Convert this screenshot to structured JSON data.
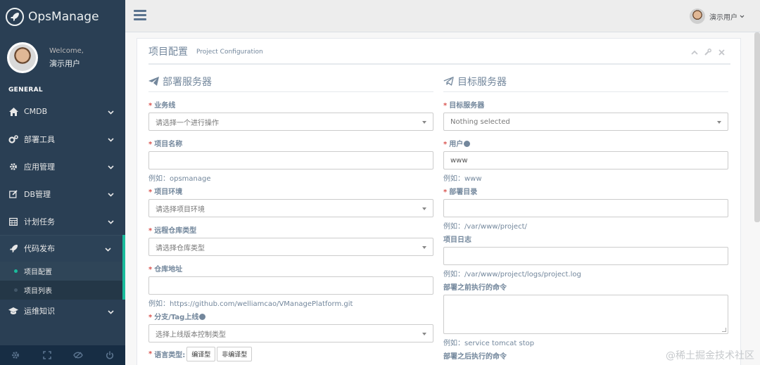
{
  "brand": {
    "name": "OpsManage"
  },
  "profile": {
    "welcome": "Welcome,",
    "name": "演示用户"
  },
  "sidebar": {
    "section": "GENERAL",
    "items": [
      {
        "label": "CMDB",
        "icon": "home-icon"
      },
      {
        "label": "部署工具",
        "icon": "cogs-icon"
      },
      {
        "label": "应用管理",
        "icon": "gear-icon"
      },
      {
        "label": "DB管理",
        "icon": "edit-icon"
      },
      {
        "label": "计划任务",
        "icon": "calendar-icon"
      },
      {
        "label": "代码发布",
        "icon": "rocket-icon"
      }
    ],
    "subitems": [
      {
        "label": "项目配置"
      },
      {
        "label": "项目列表"
      }
    ],
    "last_item": {
      "label": "运维知识",
      "icon": "graduation-cap-icon"
    }
  },
  "topbar": {
    "user": "演示用户"
  },
  "panel": {
    "title": "项目配置",
    "subtitle": "Project Configuration"
  },
  "left": {
    "heading": "部署服务器",
    "fields": {
      "business": {
        "label": "业务线",
        "placeholder": "请选择一个进行操作"
      },
      "project_name": {
        "label": "项目名称",
        "help": "例如：opsmanage"
      },
      "env": {
        "label": "项目环境",
        "placeholder": "请选择项目环境"
      },
      "repo_type": {
        "label": "远程仓库类型",
        "placeholder": "请选择仓库类型"
      },
      "repo_url": {
        "label": "仓库地址",
        "help": "例如：https://github.com/welliamcao/VManagePlatform.git"
      },
      "branch": {
        "label": "分支/Tag上线",
        "placeholder": "选择上线版本控制类型"
      },
      "lang": {
        "label": "语言类型:",
        "options": [
          "编译型",
          "非编译型"
        ]
      }
    }
  },
  "right": {
    "heading": "目标服务器",
    "fields": {
      "target": {
        "label": "目标服务器",
        "placeholder": "Nothing selected"
      },
      "user": {
        "label": "用户",
        "value": "www",
        "help": "例如：www"
      },
      "deploy_dir": {
        "label": "部署目录",
        "help": "例如：/var/www/project/"
      },
      "log": {
        "label": "项目日志",
        "help": "例如：/var/www/project/logs/project.log"
      },
      "pre_cmd": {
        "label": "部署之前执行的命令",
        "help": "例如：service tomcat stop"
      },
      "post_cmd": {
        "label": "部署之后执行的命令"
      }
    }
  },
  "watermark": "@稀土掘金技术社区",
  "colors": {
    "sidebar": "#2a3f54",
    "accent": "#1abb9c",
    "required": "#d9534f"
  }
}
